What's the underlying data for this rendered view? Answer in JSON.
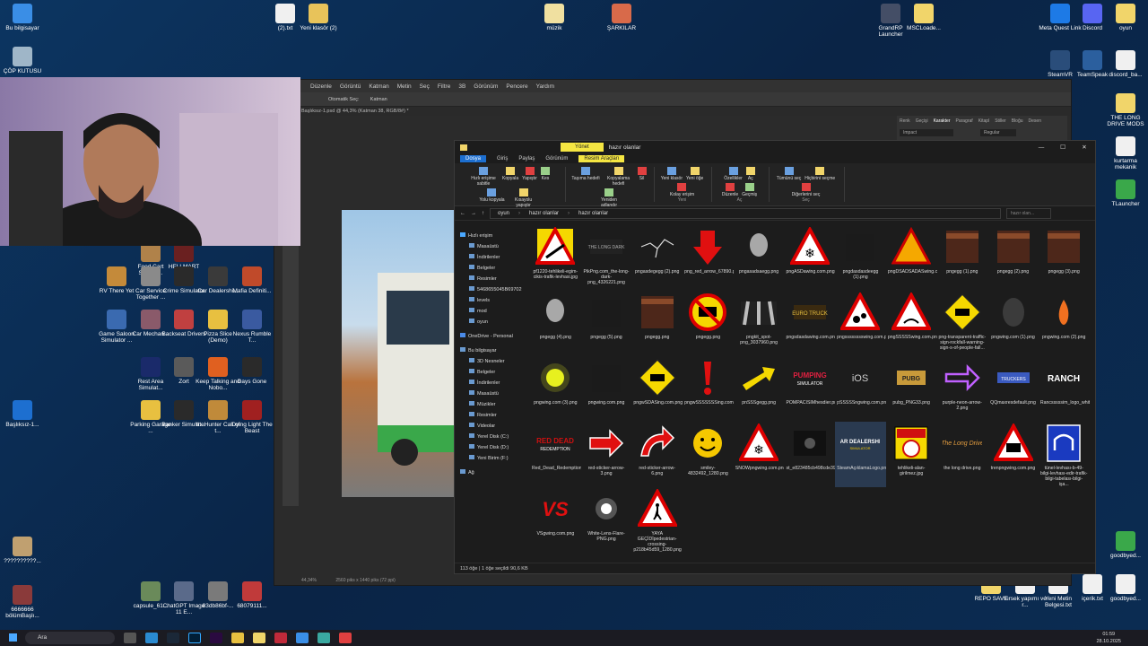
{
  "desktop": {
    "icons": [
      {
        "label": "Bu bilgisayar",
        "color": "#3a8ee6"
      },
      {
        "label": "ÇÖP KUTUSU",
        "color": "#9fb6c8"
      },
      {
        "label": "(2).txt",
        "color": "#f0f0f0"
      },
      {
        "label": "Yeni klasör (2)",
        "color": "#e8c35a"
      },
      {
        "label": "müzik",
        "color": "#f0e0a0"
      },
      {
        "label": "ŞARKILAR",
        "color": "#d86a4a"
      },
      {
        "label": "GrandRP Launcher",
        "color": "#444e66"
      },
      {
        "label": "MSCLoade...",
        "color": "#f1d56a"
      },
      {
        "label": "Meta Quest Link",
        "color": "#1d7ae6"
      },
      {
        "label": "Discord",
        "color": "#5865f2"
      },
      {
        "label": "oyun",
        "color": "#f1d56a"
      },
      {
        "label": "SteamVR",
        "color": "#2a4d7a"
      },
      {
        "label": "TeamSpeak",
        "color": "#2b5f9e"
      },
      {
        "label": "discord_ba...",
        "color": "#f0f0f0"
      },
      {
        "label": "THE LONG DRIVE MODS",
        "color": "#f1d56a"
      },
      {
        "label": "kurtarma mekanik",
        "color": "#f0f0f0"
      },
      {
        "label": "TLauncher",
        "color": "#3aa84a"
      },
      {
        "label": "Food Cart Simulat...",
        "color": "#b0824a"
      },
      {
        "label": "HELLMART Demo",
        "color": "#6a2020"
      },
      {
        "label": "RV There Yet",
        "color": "#c48a3a"
      },
      {
        "label": "Car Service Together ...",
        "color": "#8a8a8a"
      },
      {
        "label": "Crime Simulator",
        "color": "#2a2a2a"
      },
      {
        "label": "Car Dealershi...",
        "color": "#3a3a3a"
      },
      {
        "label": "Mafia Definiti...",
        "color": "#c04a2a"
      },
      {
        "label": "Game Saloon Simulator ...",
        "color": "#3a6ab0"
      },
      {
        "label": "Car Mechan...",
        "color": "#8a5a6a"
      },
      {
        "label": "Backseat Drivers",
        "color": "#c04040"
      },
      {
        "label": "Pizza Slice (Demo)",
        "color": "#e8c040"
      },
      {
        "label": "Nexus Rumble T...",
        "color": "#3a5aa0"
      },
      {
        "label": "Rest Area Simulat...",
        "color": "#1a2a6a"
      },
      {
        "label": "Zort",
        "color": "#5a5a5a"
      },
      {
        "label": "Keep Talking and Nobo...",
        "color": "#e06020"
      },
      {
        "label": "Days Gone",
        "color": "#2a2a2a"
      },
      {
        "label": "Parking Garage ...",
        "color": "#e8c040"
      },
      {
        "label": "Banker Simulat...",
        "color": "#2a2a2a"
      },
      {
        "label": "theHunter Call of t...",
        "color": "#c08a3a"
      },
      {
        "label": "Dying Light The Beast",
        "color": "#a02020"
      },
      {
        "label": "Başlıksız-1...",
        "color": "#1d6fd0"
      },
      {
        "label": "capsule_61...",
        "color": "#6a8a5a"
      },
      {
        "label": "ChatGPT Image 11 E...",
        "color": "#5a6a8a"
      },
      {
        "label": "83db86bf-...",
        "color": "#7a7a7a"
      },
      {
        "label": "68079111...",
        "color": "#c03a3a"
      },
      {
        "label": "??????????...",
        "color": "#c0a070"
      },
      {
        "label": "6666666 bölümBaşlı...",
        "color": "#8a3a3a"
      },
      {
        "label": "goodbyed...",
        "color": "#3aa84a"
      },
      {
        "label": "REPO SAVE",
        "color": "#f1d56a"
      },
      {
        "label": "türsek yapımı ve r...",
        "color": "#f0f0f0"
      },
      {
        "label": "Yeni Metin Belgesi.txt",
        "color": "#f0f0f0"
      },
      {
        "label": "içerik.txt",
        "color": "#f0f0f0"
      },
      {
        "label": "goodbyed...",
        "color": "#f0f0f0"
      }
    ]
  },
  "photoshop": {
    "menu": [
      "Düzenle",
      "Görüntü",
      "Katman",
      "Metin",
      "Seç",
      "Filtre",
      "3B",
      "Görünüm",
      "Pencere",
      "Yardım"
    ],
    "tab": "Başlıksız-1.psd @ 44,3% (Katman 38, RGB/8#) *",
    "zoom_status": "44,34%",
    "doc_status": "2560 piks x 1440 piks (72 ppi)",
    "option_labels": [
      "Otomatik Seç:",
      "Katman"
    ],
    "panel_tabs": [
      "Renk",
      "Geçişi",
      "Karakter",
      "Paragraf",
      "Kitapl",
      "Stiller",
      "Bloğu",
      "Desen"
    ],
    "font_name": "Impact",
    "font_style": "Regular"
  },
  "explorer": {
    "title": "hazır olanlar",
    "manage_tab": "Yönet",
    "ribbon_tabs": [
      "Dosya",
      "Giriş",
      "Paylaş",
      "Görünüm",
      "Resim Araçları"
    ],
    "ribbon_groups": [
      {
        "name": "Pano",
        "items": [
          "Hızlı erişime sabitle",
          "Kopyala",
          "Yapıştır",
          "Kes",
          "Yolu kopyala",
          "Kısayolu yapıştır"
        ]
      },
      {
        "name": "Düzenle",
        "items": [
          "Taşıma hedefi",
          "Kopyalama hedefi",
          "Sil",
          "Yeniden adlandır"
        ]
      },
      {
        "name": "Yeni",
        "items": [
          "Yeni klasör",
          "Yeni öğe",
          "Kolay erişim"
        ]
      },
      {
        "name": "Aç",
        "items": [
          "Özellikler",
          "Aç",
          "Düzenle",
          "Geçmiş"
        ]
      },
      {
        "name": "Seç",
        "items": [
          "Tümünü seç",
          "Hiçbirini seçme",
          "Diğerlerini seç"
        ]
      }
    ],
    "breadcrumb": [
      "oyun",
      "hazır olanlar",
      "hazır olanlar"
    ],
    "search_placeholder": "hazır olan...",
    "nav": [
      "Hızlı erişim",
      "Masaüstü",
      "İndirilenler",
      "Belgeler",
      "Resimler",
      "5468655045B69702",
      "levels",
      "mod",
      "oyun",
      "OneDrive - Personal",
      "Bu bilgisayar",
      "3D Nesneler",
      "Belgeler",
      "İndirilenler",
      "Masaüstü",
      "Müzikler",
      "Resimler",
      "Videolar",
      "Yerel Disk (C:)",
      "Yerel Disk (D:)",
      "Yeni Birim (F:)",
      "Ağ"
    ],
    "files": [
      {
        "name": "pf1220-tehlikeli-egim-cikis-trafik-levhasi.jpg",
        "icon": "warning-sign"
      },
      {
        "name": "PikPng.com_the-long-dark-png_4326221.png",
        "icon": "dark-logo"
      },
      {
        "name": "pngasdegegg (2).png",
        "icon": "crack"
      },
      {
        "name": "png_red_arrow_67890.png",
        "icon": "red-arrow-down"
      },
      {
        "name": "pngasadsaegg.png",
        "icon": "smoke"
      },
      {
        "name": "pngASDawing.com.png",
        "icon": "snow-sign"
      },
      {
        "name": "pngdasdasdeegg (1).png",
        "icon": "dark"
      },
      {
        "name": "pngDSADSADASwing.com.png",
        "icon": "warning-yellow"
      },
      {
        "name": "pngegg (1).png",
        "icon": "rust"
      },
      {
        "name": "pngegg (2).png",
        "icon": "rust"
      },
      {
        "name": "pngegg (3).png",
        "icon": "rust"
      },
      {
        "name": "pngegg (4).png",
        "icon": "smoke"
      },
      {
        "name": "pngegg (5).png",
        "icon": "dark"
      },
      {
        "name": "pngegg.png",
        "icon": "rust"
      },
      {
        "name": "pngegg.png",
        "icon": "no-truck"
      },
      {
        "name": "pngkit_spot-png_3037960.png",
        "icon": "lights"
      },
      {
        "name": "pngsdasdawing.com.png",
        "icon": "ets-logo"
      },
      {
        "name": "pngsssssssswing.com.png",
        "icon": "rock-sign"
      },
      {
        "name": "pngSSSSSwing.com.png",
        "icon": "slippery-sign"
      },
      {
        "name": "png-transparent-traffic-sign-rockfall-warning-sign-s-of-people-fall...",
        "icon": "yellow-diamond"
      },
      {
        "name": "pngwing.com (1).png",
        "icon": "smoke-dark"
      },
      {
        "name": "pngwing.com (2).png",
        "icon": "fire"
      },
      {
        "name": "pngwing.com (3).png",
        "icon": "glow"
      },
      {
        "name": "pngwing.com.png",
        "icon": "dark"
      },
      {
        "name": "pngwSDASing.com.png",
        "icon": "yellow-diamond"
      },
      {
        "name": "pngwSSSSSSSing.com.png",
        "icon": "exclamation"
      },
      {
        "name": "pnSSSgegg.png",
        "icon": "yellow-arrow"
      },
      {
        "name": "POMPACISIMhesdier.png",
        "icon": "pumping-logo"
      },
      {
        "name": "pSSSSSngwing.com.png",
        "icon": "ios-logo"
      },
      {
        "name": "pubg_PNG33.png",
        "icon": "pubg-logo"
      },
      {
        "name": "purple-neon-arrow-2.png",
        "icon": "purple-arrow"
      },
      {
        "name": "QQmaxresdefault.png",
        "icon": "truckers-logo"
      },
      {
        "name": "Rancsssssim_logo_white.png",
        "icon": "ranch-logo"
      },
      {
        "name": "Red_Dead_Redemption_2_Logo.png",
        "icon": "rdr-logo"
      },
      {
        "name": "red-sticker-arrow-3.png",
        "icon": "red-arrow-right"
      },
      {
        "name": "red-sticker-arrow-6.png",
        "icon": "red-arrow-curve"
      },
      {
        "name": "smiley-4832492_1280.png",
        "icon": "smiley"
      },
      {
        "name": "SNOWpngwing.com.png",
        "icon": "snow-sign"
      },
      {
        "name": "st_e823485cb498cde39c4f9012a47277b21603ad.1920x1080.jpg",
        "icon": "dark-screen"
      },
      {
        "name": "SteamAçıklamaLogo.png",
        "icon": "dealership-logo"
      },
      {
        "name": "tehlikeli-alan-girilmez.jpg",
        "icon": "danger-sign"
      },
      {
        "name": "the long drive.png",
        "icon": "long-drive"
      },
      {
        "name": "trenpngwing.com.png",
        "icon": "train-sign"
      },
      {
        "name": "tünel-levhası-b-49-bilgi-levhası-edir-trafik-bilgi-tabelası-bilgi-işa...",
        "icon": "tunnel-sign"
      },
      {
        "name": "VSgwing.com.png",
        "icon": "vs-logo"
      },
      {
        "name": "White-Lens-Flare-PNG.png",
        "icon": "flare"
      },
      {
        "name": "YAYA GEÇİDİpedestrian-crossing-p218b45d59_1280.png",
        "icon": "crossing-sign"
      }
    ],
    "status": "113 öğe   |   1 öğe seçildi  90,6 KB"
  },
  "taskbar": {
    "search": "Ara",
    "time": "01:59",
    "date": "28.10.2025"
  }
}
